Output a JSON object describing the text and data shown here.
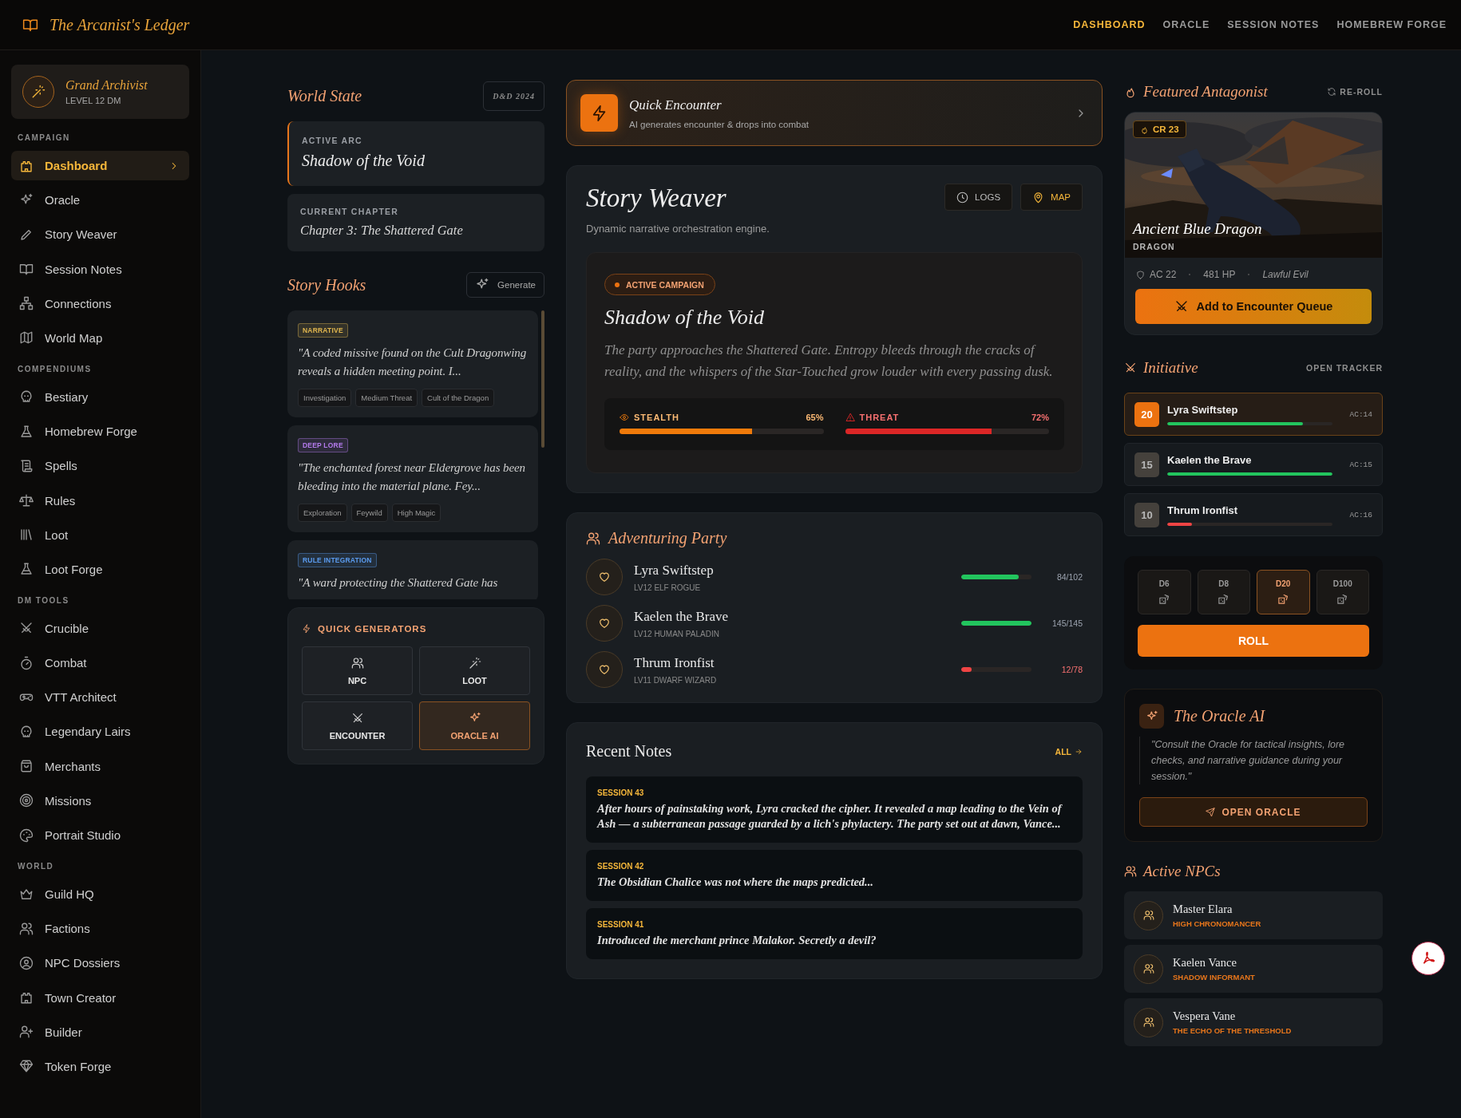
{
  "app": {
    "title": "The Arcanist's Ledger"
  },
  "top_nav": [
    {
      "label": "DASHBOARD",
      "selected": true
    },
    {
      "label": "ORACLE",
      "selected": false
    },
    {
      "label": "SESSION NOTES",
      "selected": false
    },
    {
      "label": "HOMEBREW FORGE",
      "selected": false
    }
  ],
  "profile": {
    "name": "Grand Archivist",
    "level": "LEVEL 12 DM"
  },
  "sidebar": {
    "sections": [
      {
        "title": "CAMPAIGN",
        "items": [
          {
            "label": "Dashboard",
            "selected": true
          },
          {
            "label": "Oracle",
            "selected": false
          },
          {
            "label": "Story Weaver",
            "selected": false
          },
          {
            "label": "Session Notes",
            "selected": false
          },
          {
            "label": "Connections",
            "selected": false
          },
          {
            "label": "World Map",
            "selected": false
          }
        ]
      },
      {
        "title": "COMPENDIUMS",
        "items": [
          {
            "label": "Bestiary",
            "selected": false
          },
          {
            "label": "Homebrew Forge",
            "selected": false
          },
          {
            "label": "Spells",
            "selected": false
          },
          {
            "label": "Rules",
            "selected": false
          },
          {
            "label": "Loot",
            "selected": false
          },
          {
            "label": "Loot Forge",
            "selected": false
          }
        ]
      },
      {
        "title": "DM TOOLS",
        "items": [
          {
            "label": "Crucible",
            "selected": false
          },
          {
            "label": "Combat",
            "selected": false
          },
          {
            "label": "VTT Architect",
            "selected": false
          },
          {
            "label": "Legendary Lairs",
            "selected": false
          },
          {
            "label": "Merchants",
            "selected": false
          },
          {
            "label": "Missions",
            "selected": false
          },
          {
            "label": "Portrait Studio",
            "selected": false
          }
        ]
      },
      {
        "title": "WORLD",
        "items": [
          {
            "label": "Guild HQ",
            "selected": false
          },
          {
            "label": "Factions",
            "selected": false
          },
          {
            "label": "NPC Dossiers",
            "selected": false
          },
          {
            "label": "Town Creator",
            "selected": false
          },
          {
            "label": "Builder",
            "selected": false
          },
          {
            "label": "Token Forge",
            "selected": false
          }
        ]
      }
    ]
  },
  "world_state": {
    "title": "World State",
    "edition": "D&D 2024",
    "arc_label": "ACTIVE ARC",
    "arc": "Shadow of the Void",
    "chapter_label": "CURRENT CHAPTER",
    "chapter": "Chapter 3: The Shattered Gate"
  },
  "story_hooks": {
    "title": "Story Hooks",
    "button": "Generate",
    "hooks": [
      {
        "category": "NARRATIVE",
        "color": "#e0b64f",
        "text": "\"A coded missive found on the Cult Dragonwing reveals a hidden meeting point. I...",
        "tags": [
          "Investigation",
          "Medium Threat",
          "Cult of the Dragon"
        ]
      },
      {
        "category": "DEEP LORE",
        "color": "#b57bee",
        "text": "\"The enchanted forest near Eldergrove has been bleeding into the material plane. Fey...",
        "tags": [
          "Exploration",
          "Feywild",
          "High Magic"
        ]
      },
      {
        "category": "RULE INTEGRATION",
        "color": "#5b9cf0",
        "text": "\"A ward protecting the Shattered Gate has"
      }
    ]
  },
  "quick_generators": {
    "title": "QUICK GENERATORS",
    "items": [
      {
        "label": "NPC",
        "selected": false
      },
      {
        "label": "LOOT",
        "selected": false
      },
      {
        "label": "ENCOUNTER",
        "selected": false
      },
      {
        "label": "ORACLE AI",
        "selected": true
      }
    ]
  },
  "quick_encounter": {
    "title": "Quick Encounter",
    "subtitle": "AI generates encounter & drops into combat"
  },
  "story_weaver": {
    "title": "Story Weaver",
    "subtitle": "Dynamic narrative orchestration engine.",
    "buttons": [
      {
        "label": "LOGS",
        "kind": "logs"
      },
      {
        "label": "MAP",
        "kind": "map"
      }
    ],
    "campaign": {
      "badge": "ACTIVE CAMPAIGN",
      "title": "Shadow of the Void",
      "text": "The party approaches the Shattered Gate. Entropy bleeds through the cracks of reality, and the whispers of the Star-Touched grow louder with every passing dusk.",
      "meters": [
        {
          "kind": "stealth",
          "label": "STEALTH",
          "reading": "65%",
          "level": 0.65,
          "color": "#f07a0a"
        },
        {
          "kind": "threat",
          "label": "THREAT",
          "reading": "72%",
          "level": 0.72,
          "color": "#dc2626"
        }
      ]
    }
  },
  "party": {
    "title": "Adventuring Party",
    "members": [
      {
        "name": "Lyra Swiftstep",
        "details": "LV12 ELF ROGUE",
        "hp": "84/102",
        "level": 0.82
      },
      {
        "name": "Kaelen the Brave",
        "details": "LV12 HUMAN PALADIN",
        "hp": "145/145",
        "level": 1
      },
      {
        "name": "Thrum Ironfist",
        "details": "LV11 DWARF WIZARD",
        "hp": "12/78",
        "level": 0.15
      }
    ]
  },
  "recent_notes": {
    "title": "Recent Notes",
    "link": "ALL",
    "notes": [
      {
        "session": "SESSION 43",
        "text": "After hours of painstaking work, Lyra cracked the cipher. It revealed a map leading to the Vein of Ash — a subterranean passage guarded by a lich's phylactery. The party set out at dawn, Vance..."
      },
      {
        "session": "SESSION 42",
        "text": "The Obsidian Chalice was not where the maps predicted..."
      },
      {
        "session": "SESSION 41",
        "text": "Introduced the merchant prince Malakor. Secretly a devil?"
      }
    ]
  },
  "antagonist": {
    "title": "Featured Antagonist",
    "action": "RE-ROLL",
    "cr": "CR 23",
    "name": "Ancient Blue Dragon",
    "type": "DRAGON",
    "ac": "AC 22",
    "hp": "481 HP",
    "alignment": "Lawful Evil",
    "button": "Add to Encounter Queue"
  },
  "initiative": {
    "title": "Initiative",
    "link": "OPEN TRACKER",
    "entries": [
      {
        "roll": "20",
        "name": "Lyra Swiftstep",
        "ac": "AC:14",
        "level": 0.82,
        "selected": true
      },
      {
        "roll": "15",
        "name": "Kaelen the Brave",
        "ac": "AC:15",
        "level": 1,
        "selected": false
      },
      {
        "roll": "10",
        "name": "Thrum Ironfist",
        "ac": "AC:16",
        "level": 0.15,
        "selected": false
      }
    ]
  },
  "dice": {
    "options": [
      {
        "label": "D6",
        "selected": false
      },
      {
        "label": "D8",
        "selected": false
      },
      {
        "label": "D20",
        "selected": true
      },
      {
        "label": "D100",
        "selected": false
      }
    ],
    "button": "ROLL"
  },
  "oracle": {
    "title": "The Oracle AI",
    "quote": "\"Consult the Oracle for tactical insights, lore checks, and narrative guidance during your session.\"",
    "button": "OPEN ORACLE"
  },
  "npcs": {
    "title": "Active NPCs",
    "items": [
      {
        "name": "Master Elara",
        "role": "HIGH CHRONOMANCER"
      },
      {
        "name": "Kaelen Vance",
        "role": "SHADOW INFORMANT"
      },
      {
        "name": "Vespera Vane",
        "role": "THE ECHO OF THE THRESHOLD"
      }
    ]
  }
}
